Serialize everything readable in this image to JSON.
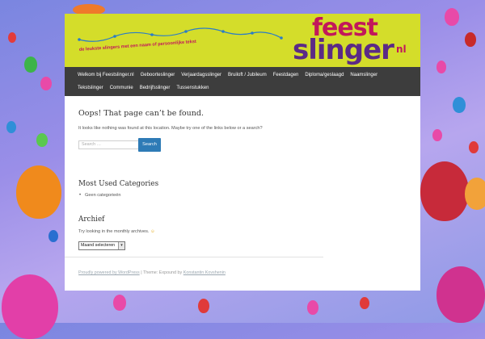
{
  "brand": {
    "line1": "feest",
    "line2": "slinger",
    "suffix": "nl",
    "slogan": "de leukste slingers met een naam of persoonlijke tekst"
  },
  "nav": {
    "row1": [
      "Welkom bij Feestslinger.nl",
      "Geboorteslinger",
      "Verjaardagsslinger",
      "Bruiloft / Jubileum",
      "Feestdagen",
      "Diploma/geslaagd",
      "Naamslinger"
    ],
    "row2": [
      "Tekstslinger",
      "Communie",
      "Bedrijfsslinger",
      "Tussenstukken"
    ]
  },
  "notfound": {
    "title": "Oops! That page can’t be found.",
    "message": "It looks like nothing was found at this location. Maybe try one of the links below or a search?"
  },
  "search": {
    "placeholder": "Search …",
    "button": "Search"
  },
  "categories": {
    "heading": "Most Used Categories",
    "items": [
      "Geen categorieën"
    ]
  },
  "archive": {
    "heading": "Archief",
    "text": "Try looking in the monthly archives.",
    "emoji": "☺",
    "select_value": "Maand selecteren"
  },
  "footer": {
    "powered": "Proudly powered by WordPress",
    "separator": " | Theme: Expound by ",
    "author": "Konstantin Kovshenin"
  },
  "colors": {
    "banner": "#d4dd2a",
    "nav": "#3d3d3d",
    "button": "#2e7bb6",
    "brand_pink": "#c2185b",
    "brand_purple": "#5b2a86"
  }
}
